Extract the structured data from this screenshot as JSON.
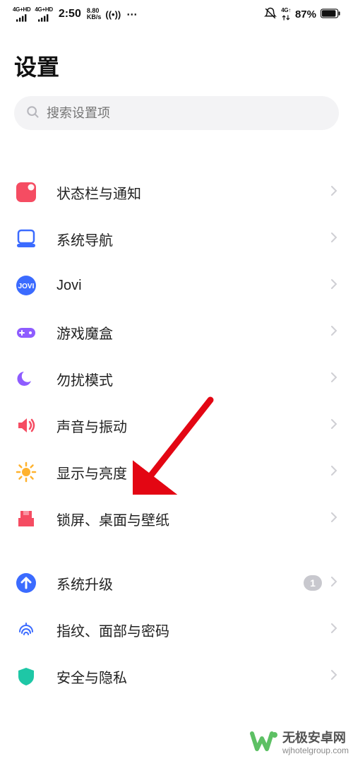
{
  "status": {
    "signal1_label": "4G+HD",
    "signal2_label": "4G+HD",
    "time": "2:50",
    "speed_num": "8.80",
    "speed_unit": "KB/s",
    "net_label": "4G↑",
    "battery_pct": "87%"
  },
  "header": {
    "title": "设置"
  },
  "search": {
    "placeholder": "搜索设置项"
  },
  "groups": [
    {
      "items": [
        {
          "icon": "statusbar-icon",
          "label": "状态栏与通知"
        },
        {
          "icon": "navigation-icon",
          "label": "系统导航"
        },
        {
          "icon": "jovi-icon",
          "label": "Jovi"
        },
        {
          "icon": "gamebox-icon",
          "label": "游戏魔盒"
        },
        {
          "icon": "dnd-icon",
          "label": "勿扰模式"
        },
        {
          "icon": "sound-icon",
          "label": "声音与振动"
        },
        {
          "icon": "brightness-icon",
          "label": "显示与亮度"
        },
        {
          "icon": "wallpaper-icon",
          "label": "锁屏、桌面与壁纸"
        }
      ]
    },
    {
      "items": [
        {
          "icon": "upgrade-icon",
          "label": "系统升级",
          "badge": "1"
        },
        {
          "icon": "fingerprint-icon",
          "label": "指纹、面部与密码"
        },
        {
          "icon": "security-icon",
          "label": "安全与隐私"
        }
      ]
    }
  ],
  "watermark": {
    "brand": "无极安卓网",
    "domain": "wjhotelgroup.com"
  }
}
